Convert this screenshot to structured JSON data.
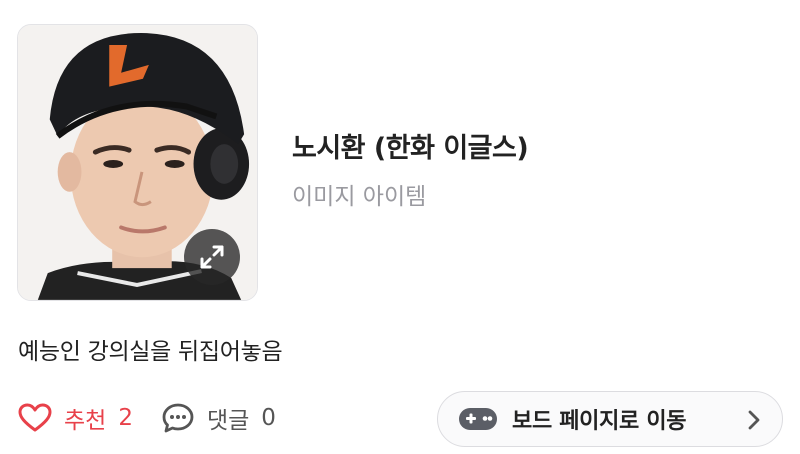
{
  "item": {
    "name": "노시환 (한화 이글스)",
    "type": "이미지 아이템",
    "image_alt": "노시환 선수 사진"
  },
  "post": {
    "text": "예능인 강의실을 뒤집어놓음"
  },
  "actions": {
    "recommend_label": "추천",
    "recommend_count": "2",
    "comment_label": "댓글",
    "comment_count": "0"
  },
  "board_button": {
    "label": "보드 페이지로 이동"
  },
  "icons": {
    "expand": "expand-icon",
    "heart": "heart-icon",
    "comment": "comment-bubble-icon",
    "gamepad": "gamepad-icon",
    "chevron": "chevron-right-icon"
  },
  "colors": {
    "accent": "#e8414a",
    "muted": "#9a9aa0"
  }
}
